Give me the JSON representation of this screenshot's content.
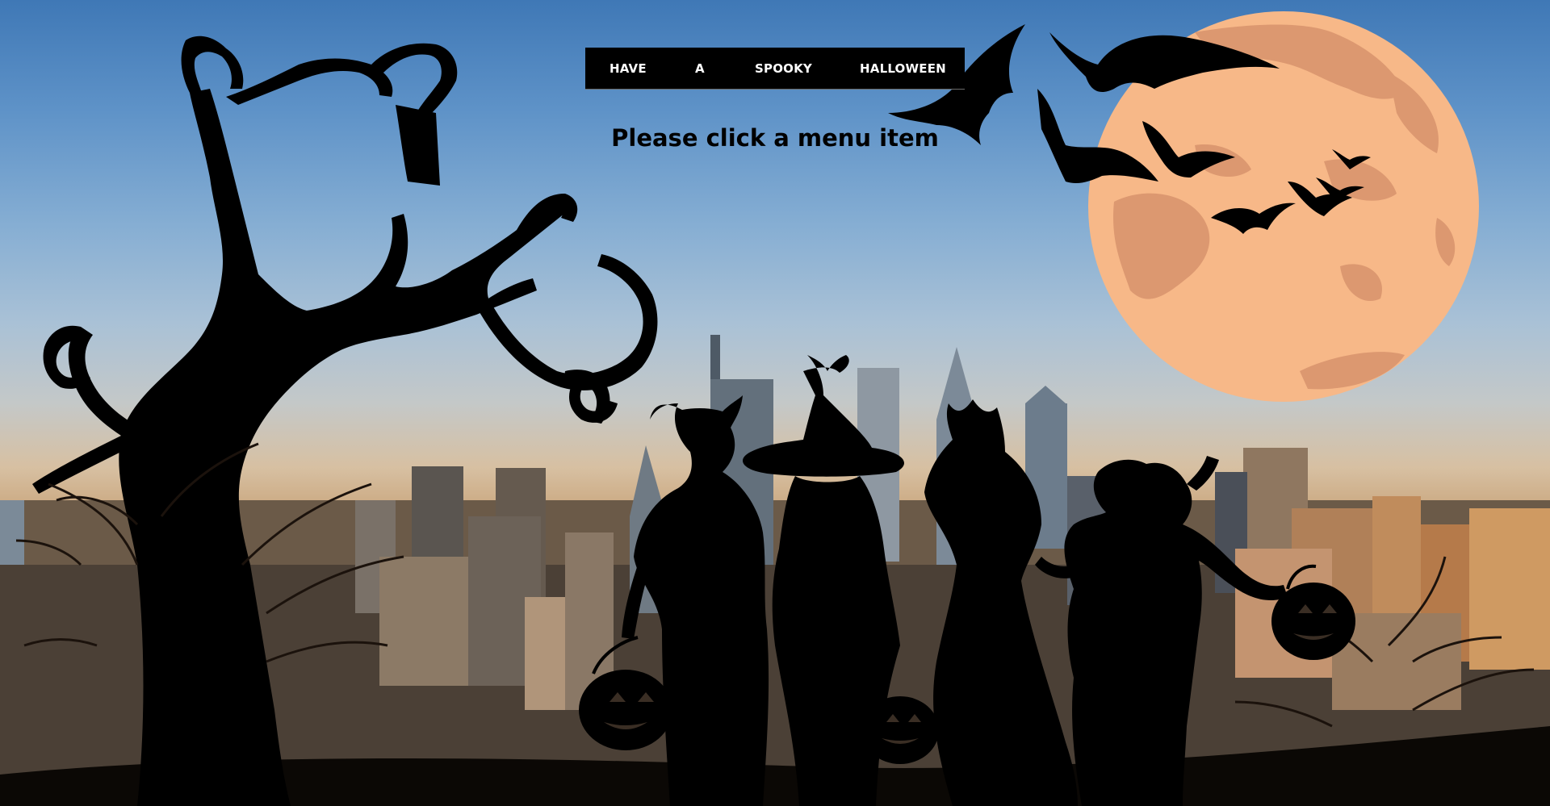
{
  "menu": {
    "items": [
      {
        "label": "HAVE"
      },
      {
        "label": "A"
      },
      {
        "label": "SPOOKY"
      },
      {
        "label": "HALLOWEEN"
      }
    ]
  },
  "message": "Please click a menu item",
  "colors": {
    "menu_background": "#000000",
    "menu_text": "#ffffff",
    "message_text": "#000000",
    "moon": "#f7b888",
    "moon_craters": "#dc9870",
    "silhouette": "#000000"
  },
  "background_icons": [
    "tree-silhouette",
    "moon",
    "bats",
    "city-skyline",
    "trick-or-treaters-silhouette",
    "jack-o-lantern-bucket"
  ]
}
